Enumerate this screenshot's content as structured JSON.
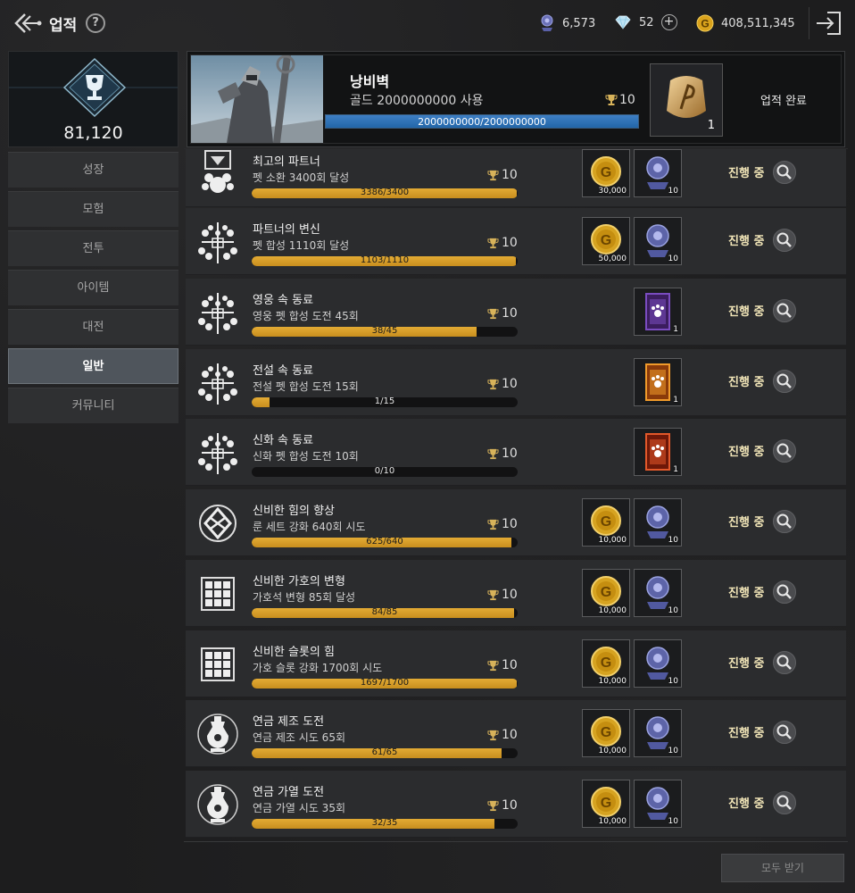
{
  "header": {
    "title": "업적",
    "help": "?",
    "currencies": [
      {
        "name": "badge",
        "icon": "badge-icon",
        "value": "6,573"
      },
      {
        "name": "diamond",
        "icon": "diamond-icon",
        "value": "52"
      },
      {
        "name": "gold",
        "icon": "gold-coin-icon",
        "value": "408,511,345"
      }
    ],
    "plus": "+"
  },
  "profile": {
    "score": "81,120"
  },
  "categories": [
    {
      "label": "성장"
    },
    {
      "label": "모험"
    },
    {
      "label": "전투"
    },
    {
      "label": "아이템"
    },
    {
      "label": "대전"
    },
    {
      "label": "일반",
      "active": true
    },
    {
      "label": "커뮤니티"
    }
  ],
  "featured": {
    "title": "낭비벽",
    "desc": "골드 2000000000 사용",
    "trophy": "10",
    "progress_text": "2000000000/2000000000",
    "progress": 1.0,
    "reward_count": "1",
    "status": "업적 완료"
  },
  "achievements": [
    {
      "icon": "partner-summon-icon",
      "name": "최고의 파트너",
      "desc": "펫 소환 3400회 달성",
      "trophy": "10",
      "progress_text": "3386/3400",
      "progress": 0.996,
      "rewards": [
        {
          "type": "gold",
          "count": "30,000"
        },
        {
          "type": "badge",
          "count": "10"
        }
      ],
      "status": "진행 중"
    },
    {
      "icon": "paw-cross-icon",
      "name": "파트너의 변신",
      "desc": "펫 합성 1110회 달성",
      "trophy": "10",
      "progress_text": "1103/1110",
      "progress": 0.994,
      "rewards": [
        {
          "type": "gold",
          "count": "50,000"
        },
        {
          "type": "badge",
          "count": "10"
        }
      ],
      "status": "진행 중"
    },
    {
      "icon": "paw-cross-icon",
      "name": "영웅 속 동료",
      "desc": "영웅 펫 합성 도전 45회",
      "trophy": "10",
      "progress_text": "38/45",
      "progress": 0.844,
      "rewards": [
        {
          "type": "card-purple",
          "count": "1"
        }
      ],
      "status": "진행 중"
    },
    {
      "icon": "paw-cross-icon",
      "name": "전설 속 동료",
      "desc": "전설 펫 합성 도전 15회",
      "trophy": "10",
      "progress_text": "1/15",
      "progress": 0.067,
      "rewards": [
        {
          "type": "card-orange",
          "count": "1"
        }
      ],
      "status": "진행 중"
    },
    {
      "icon": "paw-cross-icon",
      "name": "신화 속 동료",
      "desc": "신화 펫 합성 도전 10회",
      "trophy": "10",
      "progress_text": "0/10",
      "progress": 0.0,
      "rewards": [
        {
          "type": "card-red",
          "count": "1"
        }
      ],
      "status": "진행 중"
    },
    {
      "icon": "rune-icon",
      "name": "신비한 힘의 향상",
      "desc": "룬 세트 강화 640회 시도",
      "trophy": "10",
      "progress_text": "625/640",
      "progress": 0.977,
      "rewards": [
        {
          "type": "gold",
          "count": "10,000"
        },
        {
          "type": "badge",
          "count": "10"
        }
      ],
      "status": "진행 중"
    },
    {
      "icon": "dice-grid-icon",
      "name": "신비한 가호의 변형",
      "desc": "가호석 변형 85회 달성",
      "trophy": "10",
      "progress_text": "84/85",
      "progress": 0.988,
      "rewards": [
        {
          "type": "gold",
          "count": "10,000"
        },
        {
          "type": "badge",
          "count": "10"
        }
      ],
      "status": "진행 중"
    },
    {
      "icon": "dice-grid-icon",
      "name": "신비한 슬롯의 힘",
      "desc": "가호 슬롯 강화 1700회 시도",
      "trophy": "10",
      "progress_text": "1697/1700",
      "progress": 0.998,
      "rewards": [
        {
          "type": "gold",
          "count": "10,000"
        },
        {
          "type": "badge",
          "count": "10"
        }
      ],
      "status": "진행 중"
    },
    {
      "icon": "alchemy-flask-icon",
      "name": "연금 제조 도전",
      "desc": "연금 제조 시도 65회",
      "trophy": "10",
      "progress_text": "61/65",
      "progress": 0.938,
      "rewards": [
        {
          "type": "gold",
          "count": "10,000"
        },
        {
          "type": "badge",
          "count": "10"
        }
      ],
      "status": "진행 중"
    },
    {
      "icon": "alchemy-flask-icon",
      "name": "연금 가열 도전",
      "desc": "연금 가열 시도 35회",
      "trophy": "10",
      "progress_text": "32/35",
      "progress": 0.914,
      "rewards": [
        {
          "type": "gold",
          "count": "10,000"
        },
        {
          "type": "badge",
          "count": "10"
        }
      ],
      "status": "진행 중"
    }
  ],
  "footer": {
    "claim_all": "모두 받기"
  }
}
